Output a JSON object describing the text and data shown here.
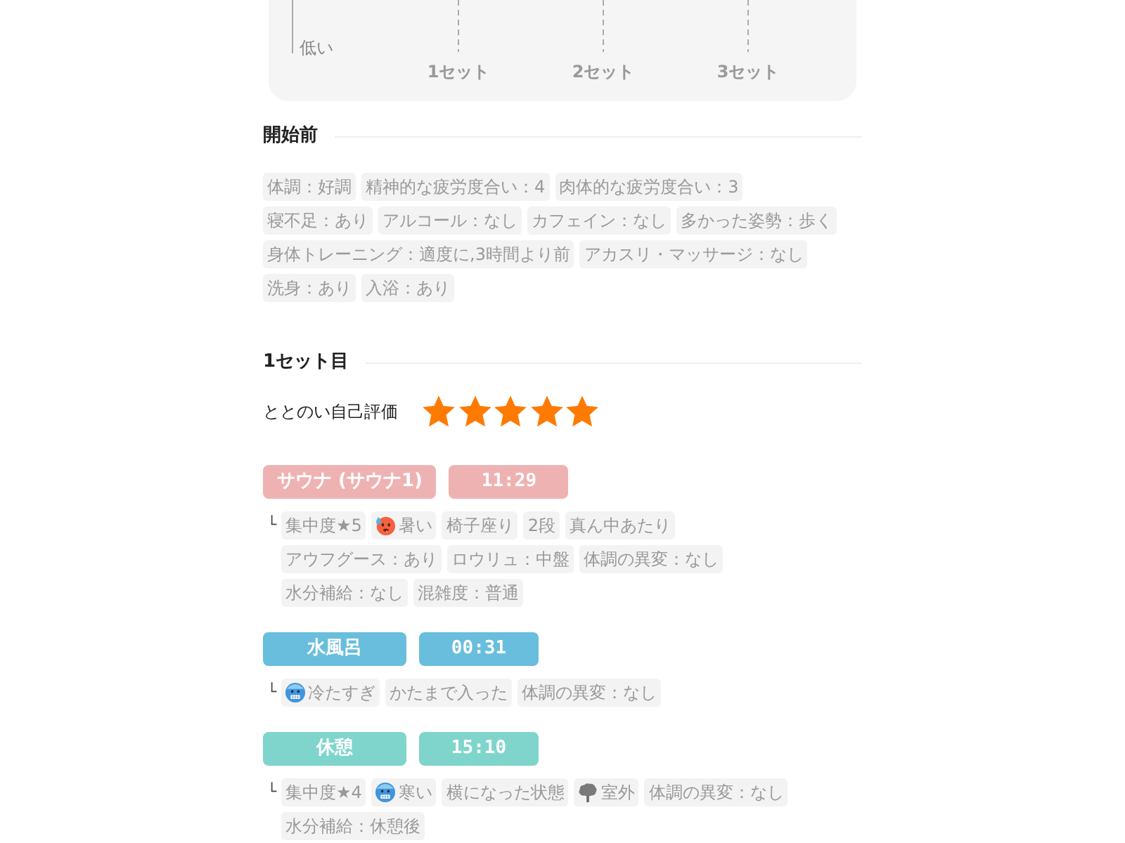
{
  "chart": {
    "y_axis_label": "低い",
    "x_labels": [
      "1セット",
      "2セット",
      "3セット"
    ]
  },
  "before": {
    "title": "開始前",
    "tags": [
      "体調：好調",
      "精神的な疲労度合い：4",
      "肉体的な疲労度合い：3",
      "寝不足：あり",
      "アルコール：なし",
      "カフェイン：なし",
      "多かった姿勢：歩く",
      "身体トレーニング：適度に,3時間より前",
      "アカスリ・マッサージ：なし",
      "洗身：あり",
      "入浴：あり"
    ]
  },
  "sets": [
    {
      "title": "1セット目",
      "rating_label": "ととのい自己評価",
      "stars": 5,
      "blocks": [
        {
          "label": "サウナ (サウナ1)",
          "time": "11:29",
          "color": "#efb2b2",
          "branch_mark": "└",
          "tags": [
            {
              "kind": "text",
              "text": "集中度★5"
            },
            {
              "kind": "hot",
              "text": "暑い"
            },
            {
              "kind": "text",
              "text": "椅子座り"
            },
            {
              "kind": "text",
              "text": "2段"
            },
            {
              "kind": "text",
              "text": "真ん中あたり"
            },
            {
              "kind": "text",
              "text": "アウフグース：あり"
            },
            {
              "kind": "text",
              "text": "ロウリュ：中盤"
            },
            {
              "kind": "text",
              "text": "体調の異変：なし"
            },
            {
              "kind": "text",
              "text": "水分補給：なし"
            },
            {
              "kind": "text",
              "text": "混雑度：普通"
            }
          ]
        },
        {
          "label": "水風呂",
          "time": "00:31",
          "color": "#68bedc",
          "branch_mark": "└",
          "tags": [
            {
              "kind": "cold",
              "text": "冷たすぎ"
            },
            {
              "kind": "text",
              "text": "かたまで入った"
            },
            {
              "kind": "text",
              "text": "体調の異変：なし"
            }
          ]
        },
        {
          "label": "休憩",
          "time": "15:10",
          "color": "#7fd5cc",
          "branch_mark": "└",
          "tags": [
            {
              "kind": "text",
              "text": "集中度★4"
            },
            {
              "kind": "cold",
              "text": "寒い"
            },
            {
              "kind": "text",
              "text": "横になった状態"
            },
            {
              "kind": "tree",
              "text": "室外"
            },
            {
              "kind": "text",
              "text": "体調の異変：なし"
            },
            {
              "kind": "text",
              "text": "水分補給：休憩後"
            }
          ]
        }
      ]
    }
  ]
}
